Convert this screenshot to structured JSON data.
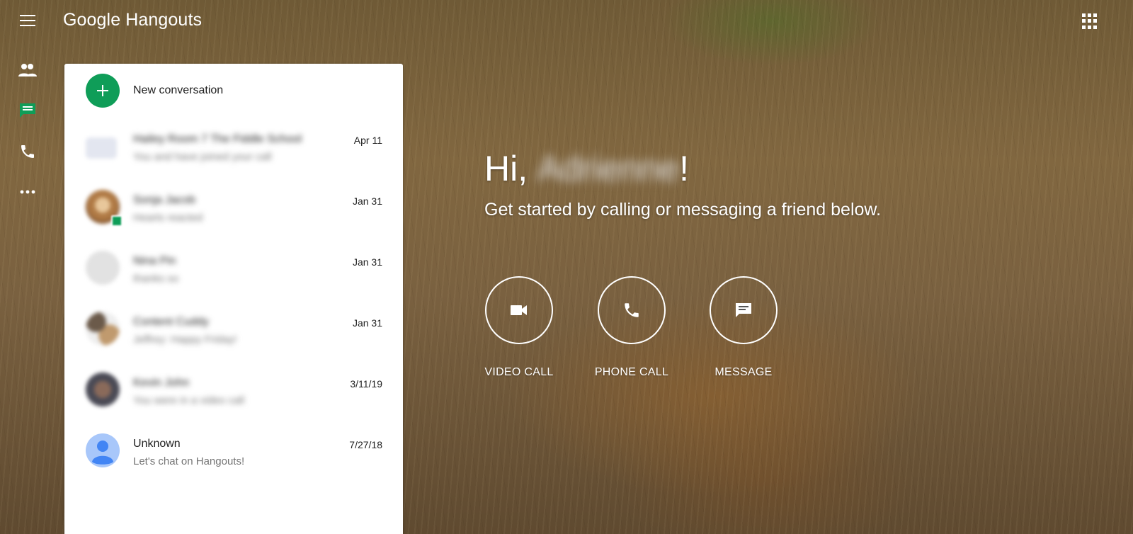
{
  "app": {
    "brand_google": "Google",
    "brand_product": "Hangouts"
  },
  "colors": {
    "accent": "#0f9d58",
    "panel": "#ffffff",
    "text": "#212121",
    "muted": "#757575"
  },
  "rail": [
    {
      "icon": "people-icon",
      "label": "Contacts"
    },
    {
      "icon": "chat-icon",
      "label": "Conversations",
      "active": true
    },
    {
      "icon": "phone-icon",
      "label": "Phone calls"
    },
    {
      "icon": "more-icon",
      "label": "More"
    }
  ],
  "new_conversation": {
    "label": "New conversation"
  },
  "conversations": [
    {
      "name": "Hailey Room 7 The Fiddle School",
      "snippet": "You and have joined your call",
      "date": "Apr 11"
    },
    {
      "name": "Sonja Jacob",
      "snippet": "Hearts reacted",
      "date": "Jan 31"
    },
    {
      "name": "Nina Pin",
      "snippet": "thanks so",
      "date": "Jan 31"
    },
    {
      "name": "Content Cuddy",
      "snippet": "Jeffrey: Happy Friday!",
      "date": "Jan 31"
    },
    {
      "name": "Kevin John",
      "snippet": "You were in a video call",
      "date": "3/11/19"
    },
    {
      "name": "Unknown",
      "snippet": "Let's chat on Hangouts!",
      "date": "7/27/18"
    }
  ],
  "greeting": {
    "prefix": "Hi, ",
    "name": "Adrienne",
    "suffix": "!",
    "subtitle": "Get started by calling or messaging a friend below."
  },
  "actions": [
    {
      "icon": "video-camera-icon",
      "label": "VIDEO CALL"
    },
    {
      "icon": "phone-icon",
      "label": "PHONE CALL"
    },
    {
      "icon": "message-icon",
      "label": "MESSAGE"
    }
  ]
}
